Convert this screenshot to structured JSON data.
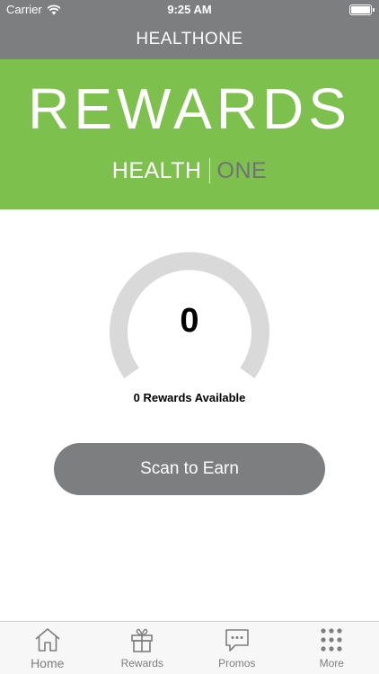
{
  "status_bar": {
    "carrier": "Carrier",
    "time": "9:25 AM"
  },
  "nav": {
    "title": "HEALTHONE"
  },
  "banner": {
    "title": "REWARDS",
    "brand_left": "HEALTH",
    "brand_right": "ONE"
  },
  "rewards": {
    "count": "0",
    "available_label": "0 Rewards Available"
  },
  "actions": {
    "scan_label": "Scan to Earn"
  },
  "tabs": [
    {
      "label": "Home",
      "icon": "home-icon"
    },
    {
      "label": "Rewards",
      "icon": "gift-icon"
    },
    {
      "label": "Promos",
      "icon": "chat-bubble-icon"
    },
    {
      "label": "More",
      "icon": "grid-dots-icon"
    }
  ],
  "colors": {
    "header_gray": "#7d7e80",
    "banner_green": "#7ec04d",
    "gauge_track": "#d9d9d9"
  }
}
